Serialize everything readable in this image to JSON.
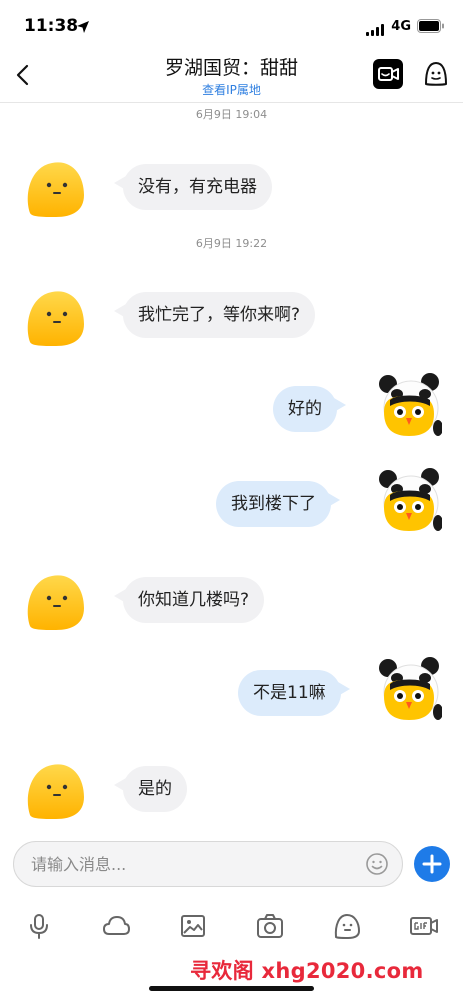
{
  "status_bar": {
    "time": "11:38",
    "network": "4G"
  },
  "nav": {
    "title": "罗湖国贸：甜甜",
    "subtitle_link": "查看IP属地"
  },
  "timestamps": [
    "6月9日 19:04",
    "6月9日 19:22"
  ],
  "messages": [
    {
      "from": "other",
      "text": "没有，有充电器"
    },
    {
      "from": "other",
      "text": "我忙完了，等你来啊?"
    },
    {
      "from": "me",
      "text": "好的"
    },
    {
      "from": "me",
      "text": "我到楼下了"
    },
    {
      "from": "other",
      "text": "你知道几楼吗?"
    },
    {
      "from": "me",
      "text": "不是11嘛"
    },
    {
      "from": "other",
      "text": "是的"
    }
  ],
  "input": {
    "placeholder": "请输入消息..."
  },
  "toolbar_icons": [
    "microphone-icon",
    "cloud-icon",
    "image-icon",
    "camera-icon",
    "sticker-icon",
    "gif-icon"
  ],
  "watermark": "寻欢阁 xhg2020.com",
  "colors": {
    "accent": "#1e7be8",
    "link": "#2f7fe0",
    "bubble_in": "#f1f1f3",
    "bubble_out": "#dcebfb",
    "avatar_yellow": "#ffc400",
    "watermark": "#e8293b"
  }
}
